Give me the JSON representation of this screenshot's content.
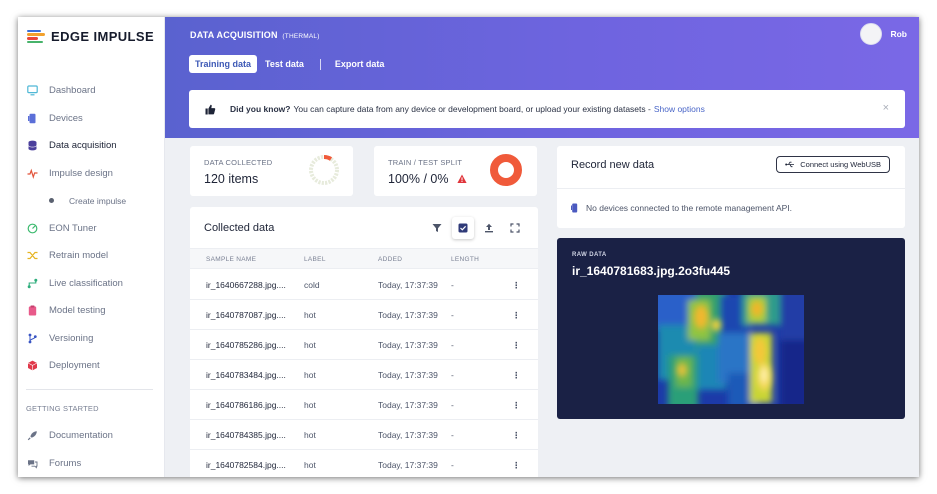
{
  "app": {
    "name": "EDGE IMPULSE",
    "user": "Rob"
  },
  "sidebar": {
    "items": [
      {
        "label": "Dashboard",
        "icon": "monitor-icon"
      },
      {
        "label": "Devices",
        "icon": "device-icon"
      },
      {
        "label": "Data acquisition",
        "icon": "database-icon",
        "active": true
      },
      {
        "label": "Impulse design",
        "icon": "pulse-icon"
      },
      {
        "label": "Create impulse",
        "icon": "dot-icon"
      },
      {
        "label": "EON Tuner",
        "icon": "tuner-icon"
      },
      {
        "label": "Retrain model",
        "icon": "shuffle-icon"
      },
      {
        "label": "Live classification",
        "icon": "flow-icon"
      },
      {
        "label": "Model testing",
        "icon": "clipboard-icon"
      },
      {
        "label": "Versioning",
        "icon": "branch-icon"
      },
      {
        "label": "Deployment",
        "icon": "box-icon"
      }
    ],
    "getting_started_heading": "GETTING STARTED",
    "getting_started": [
      {
        "label": "Documentation",
        "icon": "rocket-icon"
      },
      {
        "label": "Forums",
        "icon": "chat-icon"
      }
    ]
  },
  "header": {
    "title": "DATA ACQUISITION",
    "subtitle": "(THERMAL)",
    "tabs": [
      "Training data",
      "Test data",
      "Export data"
    ]
  },
  "banner": {
    "bold": "Did you know?",
    "text": "You can capture data from any device or development board, or upload your existing datasets -",
    "link": "Show options",
    "close": "×"
  },
  "stats": {
    "collected_label": "DATA COLLECTED",
    "collected_value": "120 items",
    "split_label": "TRAIN / TEST SPLIT",
    "split_value": "100% / 0%"
  },
  "collected": {
    "title": "Collected data",
    "columns": [
      "SAMPLE NAME",
      "LABEL",
      "ADDED",
      "LENGTH"
    ],
    "rows": [
      {
        "name": "ir_1640667288.jpg....",
        "label": "cold",
        "added": "Today, 17:37:39",
        "length": "-"
      },
      {
        "name": "ir_1640787087.jpg....",
        "label": "hot",
        "added": "Today, 17:37:39",
        "length": "-"
      },
      {
        "name": "ir_1640785286.jpg....",
        "label": "hot",
        "added": "Today, 17:37:39",
        "length": "-"
      },
      {
        "name": "ir_1640783484.jpg....",
        "label": "hot",
        "added": "Today, 17:37:39",
        "length": "-"
      },
      {
        "name": "ir_1640786186.jpg....",
        "label": "hot",
        "added": "Today, 17:37:39",
        "length": "-"
      },
      {
        "name": "ir_1640784385.jpg....",
        "label": "hot",
        "added": "Today, 17:37:39",
        "length": "-"
      },
      {
        "name": "ir_1640782584.jpg....",
        "label": "hot",
        "added": "Today, 17:37:39",
        "length": "-"
      }
    ]
  },
  "record": {
    "title": "Record new data",
    "usb_button": "Connect using WebUSB",
    "no_devices": "No devices connected to the remote management API."
  },
  "raw": {
    "label": "RAW DATA",
    "title": "ir_1640781683.jpg.2o3fu445"
  },
  "colors": {
    "accent": "#5a62cf",
    "dark_panel": "#1a2145",
    "split_donut": "#f05a3a",
    "warning": "#e0353b"
  }
}
